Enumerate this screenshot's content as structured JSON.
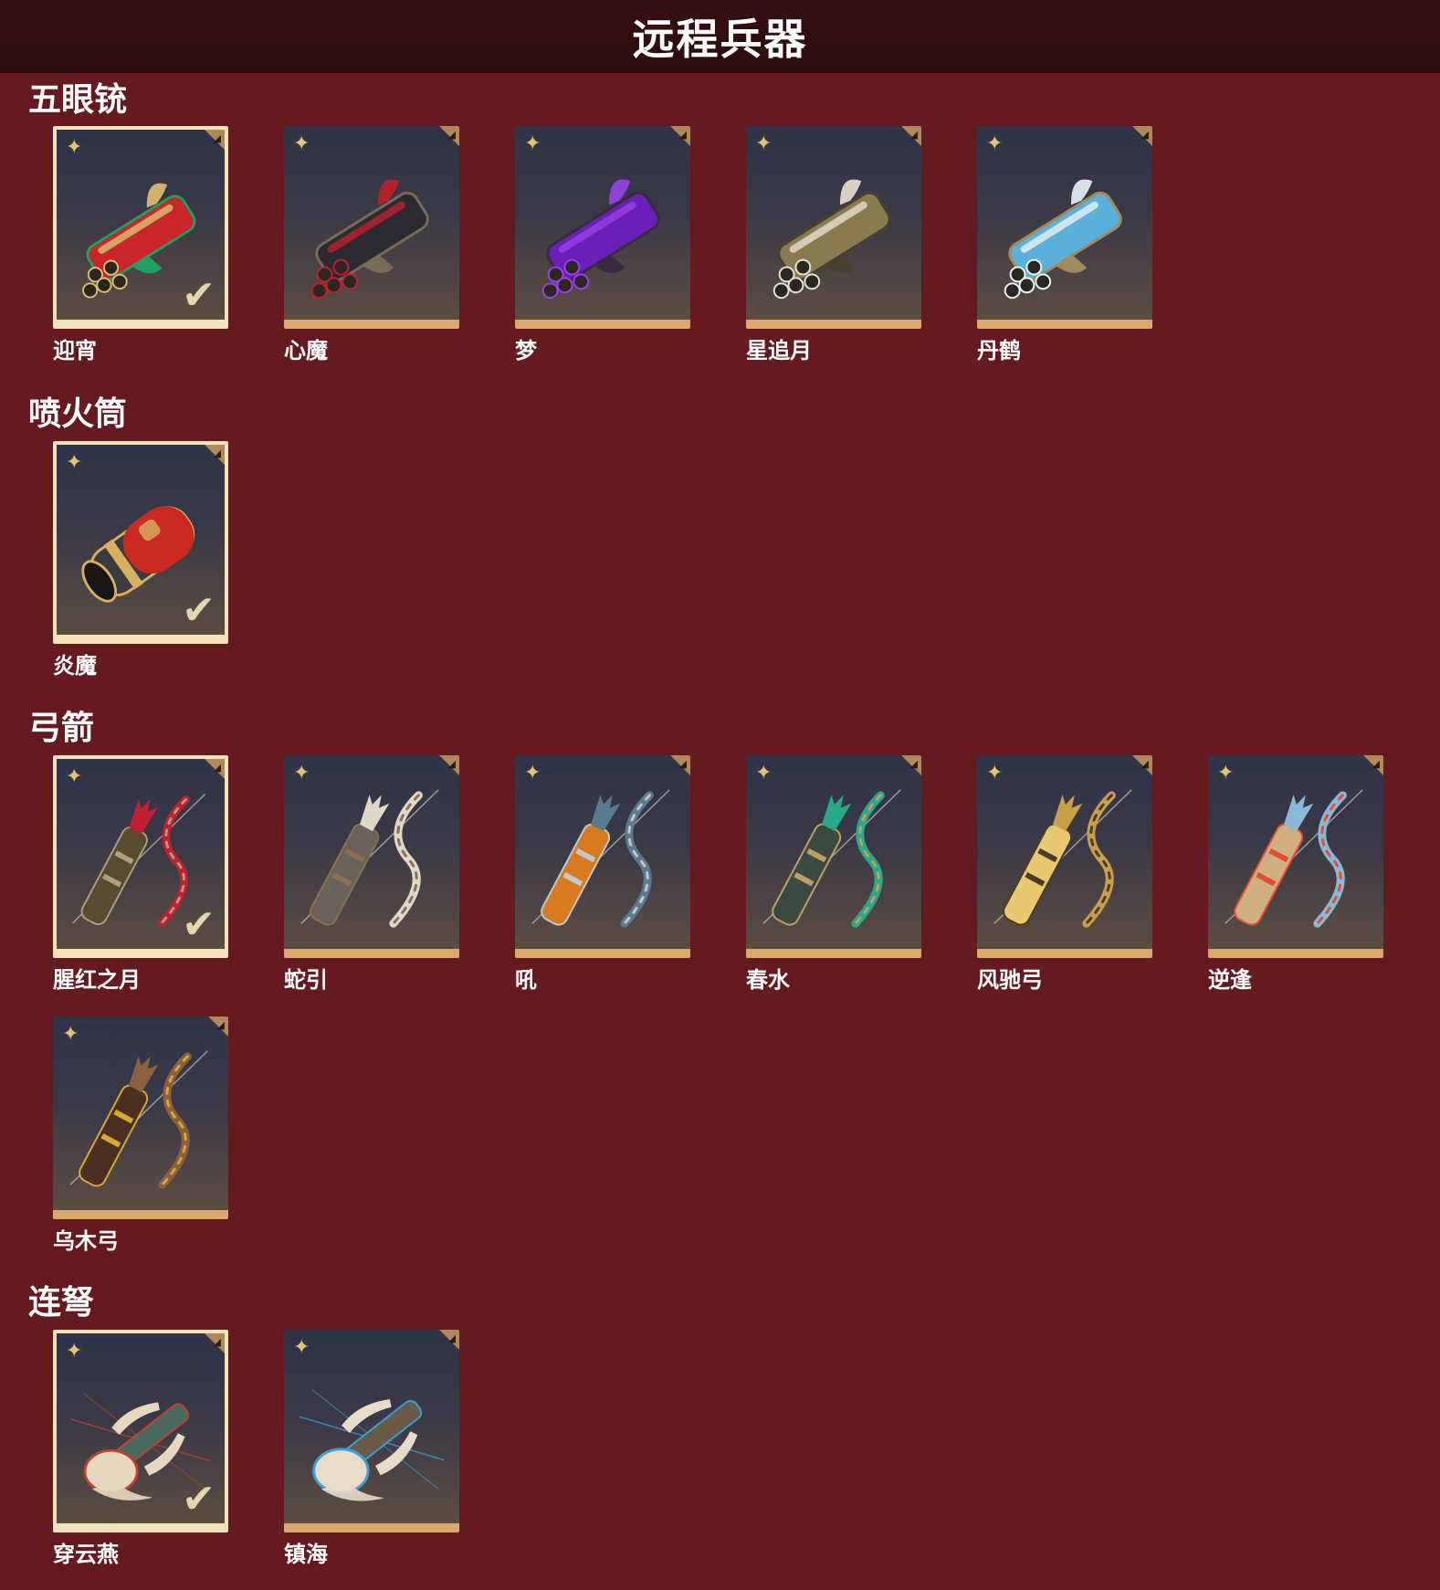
{
  "header": {
    "title": "远程兵器"
  },
  "sections": [
    {
      "title": "五眼铳",
      "items": [
        {
          "name": "迎宵",
          "equipped": true,
          "palette": [
            "#c8262a",
            "#e0c070",
            "#1fa060"
          ]
        },
        {
          "name": "心魔",
          "equipped": false,
          "palette": [
            "#2a2a30",
            "#c0202a",
            "#7a6a58"
          ]
        },
        {
          "name": "梦",
          "equipped": false,
          "palette": [
            "#6a1fb8",
            "#9a40e8",
            "#3a2a40"
          ]
        },
        {
          "name": "星追月",
          "equipped": false,
          "palette": [
            "#8a7a50",
            "#e8e0d0",
            "#4a4030"
          ]
        },
        {
          "name": "丹鹤",
          "equipped": false,
          "palette": [
            "#5ab0d8",
            "#e8f4f8",
            "#a08a60"
          ]
        }
      ]
    },
    {
      "title": "喷火筒",
      "items": [
        {
          "name": "炎魔",
          "equipped": true,
          "palette": [
            "#c82a20",
            "#d8b060",
            "#3a3a40"
          ]
        }
      ]
    },
    {
      "title": "弓箭",
      "items": [
        {
          "name": "腥红之月",
          "equipped": true,
          "palette": [
            "#c02030",
            "#b0a080",
            "#5a4a30"
          ]
        },
        {
          "name": "蛇引",
          "equipped": false,
          "palette": [
            "#e0d8c8",
            "#8a7050",
            "#6a6258"
          ]
        },
        {
          "name": "吼",
          "equipped": false,
          "palette": [
            "#5a7a90",
            "#c0c8d0",
            "#d87a20"
          ]
        },
        {
          "name": "春水",
          "equipped": false,
          "palette": [
            "#2aa88a",
            "#c0a060",
            "#3a4a40"
          ]
        },
        {
          "name": "风驰弓",
          "equipped": false,
          "palette": [
            "#c8a048",
            "#4a3a28",
            "#e8c870"
          ]
        },
        {
          "name": "逆逢",
          "equipped": false,
          "palette": [
            "#8ab8d8",
            "#e05030",
            "#d0b080"
          ]
        },
        {
          "name": "乌木弓",
          "equipped": false,
          "palette": [
            "#8a6040",
            "#d8a830",
            "#4a3020"
          ]
        }
      ]
    },
    {
      "title": "连弩",
      "items": [
        {
          "name": "穿云燕",
          "equipped": true,
          "palette": [
            "#e8d8c0",
            "#c04030",
            "#4a6a60"
          ]
        },
        {
          "name": "镇海",
          "equipped": false,
          "palette": [
            "#e8dcc8",
            "#3aa0d8",
            "#6a5a48"
          ]
        }
      ]
    }
  ],
  "icons": {
    "rarity": "four-petal-star-icon",
    "rarity_glyph": "✦",
    "equipped": "checkmark-icon",
    "equipped_glyph": "✔"
  },
  "colors": {
    "background": "#651a20",
    "header_bar": "#2b0c0e",
    "card_accent": "#d9a86a",
    "equipped_border": "#f2e3b8"
  }
}
